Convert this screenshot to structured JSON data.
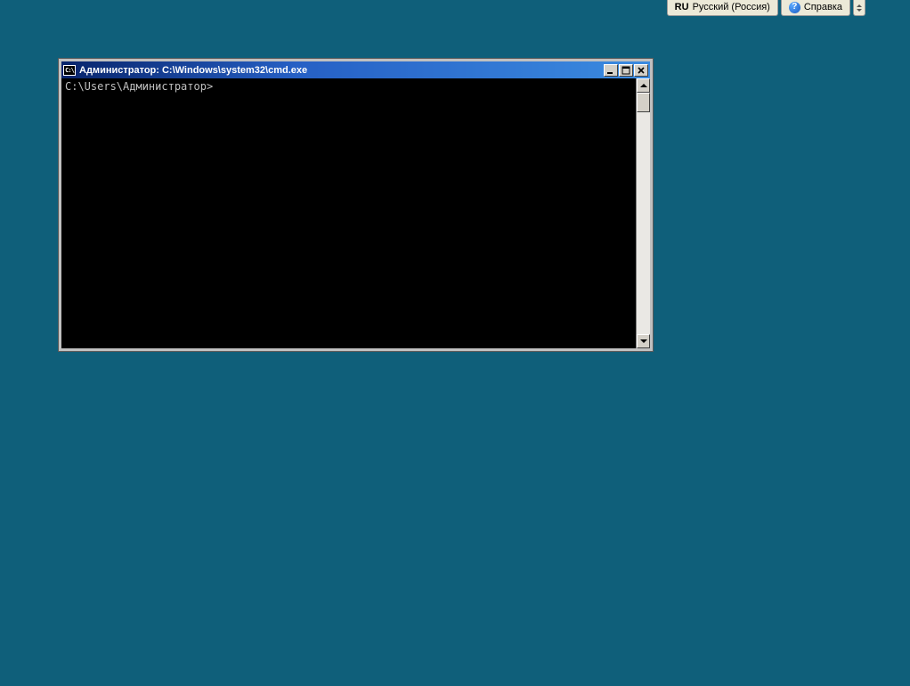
{
  "toolbar": {
    "language": {
      "code": "RU",
      "name": "Русский (Россия)"
    },
    "help_label": "Справка"
  },
  "window": {
    "title": "Администратор: C:\\Windows\\system32\\cmd.exe",
    "icon_label": "C:\\",
    "console_prompt": "C:\\Users\\Администратор>"
  }
}
